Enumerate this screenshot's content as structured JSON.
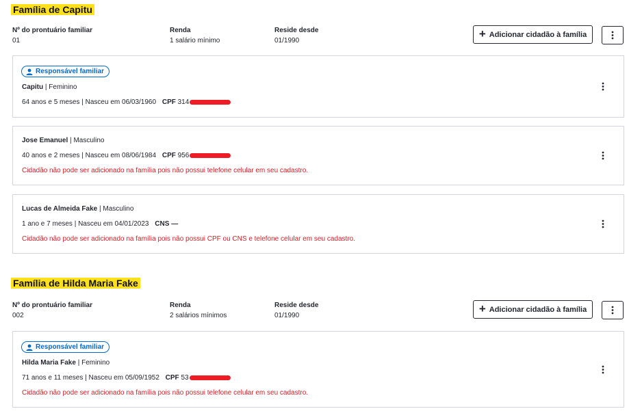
{
  "labels": {
    "prontuario": "Nº do prontuário familiar",
    "renda": "Renda",
    "reside": "Reside desde",
    "add_button": "Adicionar cidadão à família",
    "badge": "Responsável familiar"
  },
  "families": [
    {
      "title": "Família de Capitu",
      "prontuario": "01",
      "renda": "1 salário mínimo",
      "reside": "01/1990",
      "members": [
        {
          "name": "Capitu",
          "sex": "Feminino",
          "age": "64 anos e 5 meses | Nasceu em 06/03/1960",
          "doc_label": "CPF",
          "doc_value": "314",
          "error": ""
        },
        {
          "name": "Jose Emanuel",
          "sex": "Masculino",
          "age": "40 anos e 2 meses | Nasceu em 08/06/1984",
          "doc_label": "CPF",
          "doc_value": "956",
          "error": "Cidadão não pode ser adicionado na família pois não possui telefone celular em seu cadastro."
        },
        {
          "name": "Lucas de Almeida Fake",
          "sex": "Masculino",
          "age": "1 ano e 7 meses | Nasceu em 04/01/2023",
          "doc_label": "CNS",
          "doc_value": "—",
          "error": "Cidadão não pode ser adicionado na família pois não possui CPF ou CNS e telefone celular em seu cadastro."
        }
      ]
    },
    {
      "title": "Família de Hilda Maria Fake",
      "prontuario": "002",
      "renda": "2 salários mínimos",
      "reside": "01/1990",
      "members": [
        {
          "name": "Hilda Maria Fake",
          "sex": "Feminino",
          "age": "71 anos e 11 meses | Nasceu em 05/09/1952",
          "doc_label": "CPF",
          "doc_value": "53",
          "error": "Cidadão não pode ser adicionado na família pois não possui telefone celular em seu cadastro."
        }
      ]
    }
  ],
  "colors": {
    "highlight": "#ffe11b",
    "error": "#d01f26",
    "accent": "#0069d0",
    "redaction": "#ee1c24"
  },
  "icons": {
    "add": "plus-icon",
    "more": "kebab-icon",
    "person": "person-icon"
  }
}
